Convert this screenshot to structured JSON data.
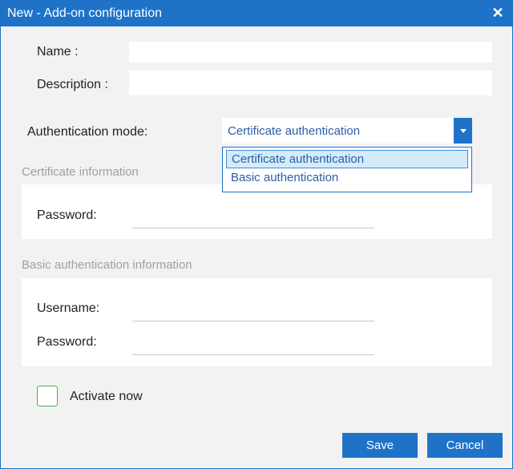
{
  "window": {
    "title": "New - Add-on configuration",
    "close_glyph": "✕"
  },
  "fields": {
    "name_label": "Name :",
    "name_value": "",
    "description_label": "Description :",
    "description_value": ""
  },
  "auth": {
    "mode_label": "Authentication mode:",
    "selected": "Certificate authentication",
    "options": [
      "Certificate authentication",
      "Basic authentication"
    ]
  },
  "certificate_section": {
    "title": "Certificate information",
    "password_label": "Password:",
    "password_value": ""
  },
  "basic_section": {
    "title": "Basic authentication information",
    "username_label": "Username:",
    "username_value": "",
    "password_label": "Password:",
    "password_value": ""
  },
  "activate": {
    "label": "Activate now",
    "checked": false
  },
  "buttons": {
    "save": "Save",
    "cancel": "Cancel"
  },
  "colors": {
    "accent": "#1e73c8",
    "checkbox_border": "#4caf50",
    "section_title": "#a0a0a0"
  }
}
